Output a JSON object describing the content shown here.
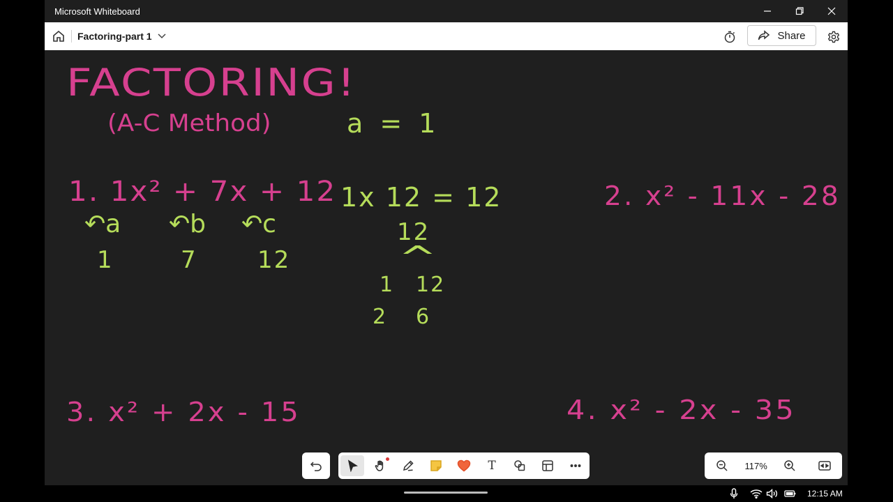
{
  "window": {
    "title": "Microsoft Whiteboard"
  },
  "appbar": {
    "board_title": "Factoring-part 1",
    "share_label": "Share"
  },
  "colors": {
    "pink_ink": "#d6408f",
    "green_ink": "#b5dc5a",
    "canvas": "#1f1f1f"
  },
  "whiteboard": {
    "heading": "FACTORING!",
    "subheading": "(A-C Method)",
    "a_note": "a = 1",
    "problem1": "1. 1x² + 7x + 12",
    "label_a": "↶a",
    "label_b": "↶b",
    "label_c": "↶c",
    "val_a": "1",
    "val_b": "7",
    "val_c": "12",
    "product": "1x 12 = 12",
    "tree_top": "12",
    "tree_branch": "^",
    "pair1_left": "1",
    "pair1_right": "12",
    "pair2_left": "2",
    "pair2_right": "6",
    "problem2": "2. x² - 11x - 28",
    "problem3": "3. x² + 2x - 15",
    "problem4": "4. x² - 2x - 35"
  },
  "zoom": {
    "level": "117%"
  },
  "system": {
    "time": "12:15 AM"
  },
  "icons": {
    "home": "home-icon",
    "chevron": "chevron-down-icon",
    "timer": "timer-icon",
    "share": "share-icon",
    "settings": "gear-icon",
    "undo": "undo-icon",
    "select": "pointer-icon",
    "pan": "hand-icon",
    "pen": "pen-icon",
    "note": "sticky-note-icon",
    "reaction": "heart-icon",
    "text": "text-icon",
    "shapes": "shapes-icon",
    "templates": "templates-icon",
    "more": "more-icon",
    "zoom_out": "zoom-out-icon",
    "zoom_in": "zoom-in-icon",
    "fit": "fit-screen-icon"
  }
}
